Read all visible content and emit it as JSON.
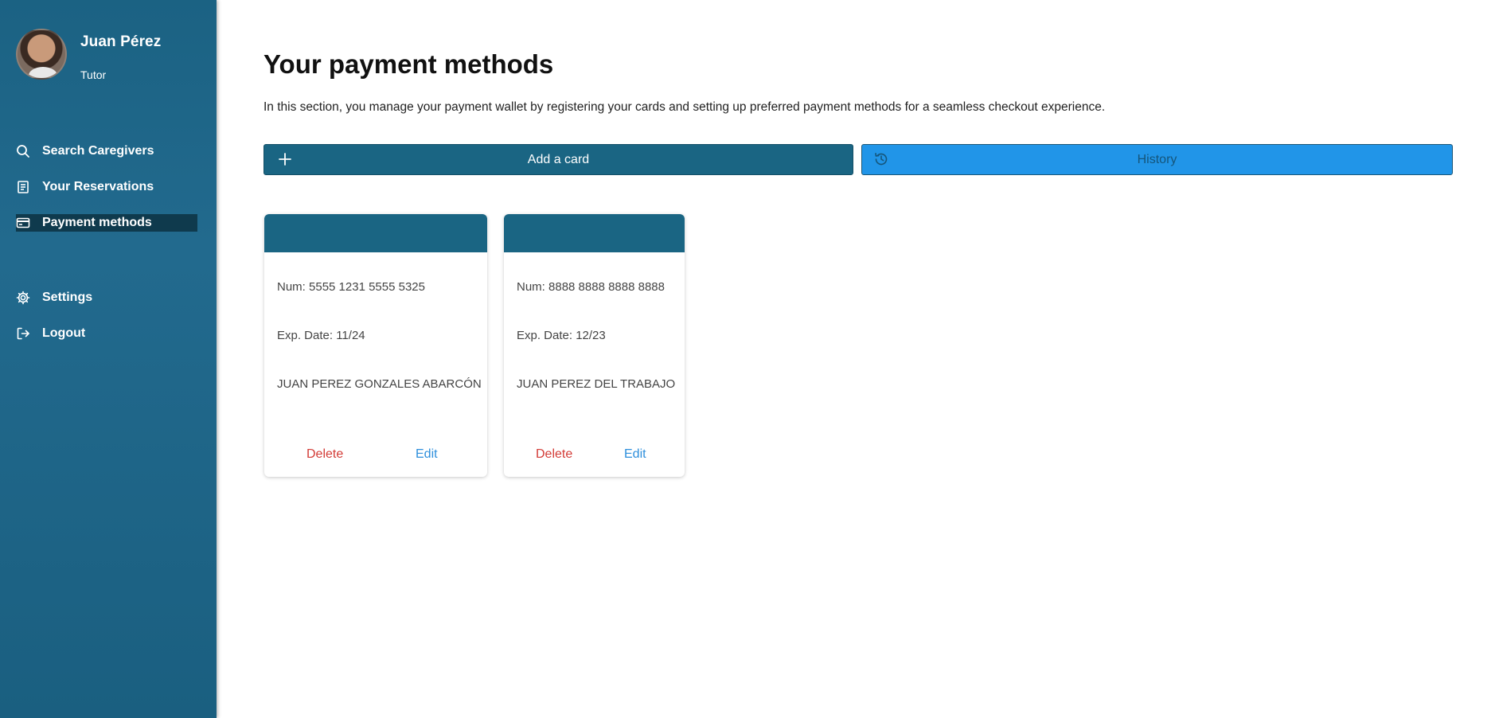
{
  "sidebar": {
    "user": {
      "name": "Juan Pérez",
      "role": "Tutor"
    },
    "items": [
      {
        "label": "Search Caregivers",
        "icon": "search-icon"
      },
      {
        "label": "Your Reservations",
        "icon": "document-icon"
      },
      {
        "label": "Payment methods",
        "icon": "credit-card-icon",
        "active": true
      },
      {
        "label": "Settings",
        "icon": "gear-icon"
      },
      {
        "label": "Logout",
        "icon": "logout-icon"
      }
    ]
  },
  "main": {
    "title": "Your payment methods",
    "description": "In this section, you manage your payment wallet by registering your cards and setting up preferred payment methods for a seamless checkout experience.",
    "add_card_label": "Add a card",
    "history_label": "History"
  },
  "cards": [
    {
      "number": "Num: 5555 1231 5555 5325",
      "exp": "Exp. Date: 11/24",
      "holder": "JUAN PEREZ GONZALES ABARCÓN",
      "delete_label": "Delete",
      "edit_label": "Edit"
    },
    {
      "number": "Num: 8888 8888 8888 8888",
      "exp": "Exp. Date: 12/23",
      "holder": "JUAN PEREZ DEL TRABAJO",
      "delete_label": "Delete",
      "edit_label": "Edit"
    }
  ],
  "colors": {
    "sidebar": "#1b6283",
    "primary": "#1a6583",
    "history": "#2195e8",
    "delete": "#d33b36",
    "edit": "#2e8fdc"
  }
}
